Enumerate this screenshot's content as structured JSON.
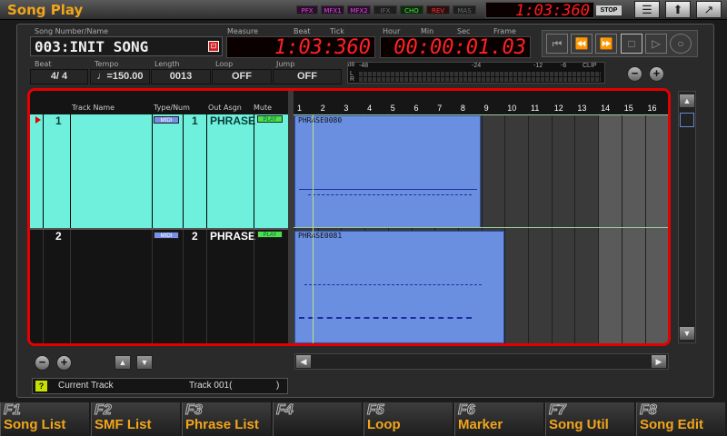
{
  "app": {
    "title": "Song Play"
  },
  "fx_badges": [
    {
      "label": "PFX",
      "color": "#d84ad8",
      "bg": "#2a0f2a"
    },
    {
      "label": "MFX1",
      "color": "#d84ad8",
      "bg": "#2a0f2a"
    },
    {
      "label": "MFX2",
      "color": "#d84ad8",
      "bg": "#2a0f2a"
    },
    {
      "label": "IFX",
      "color": "#666666",
      "bg": "#1e1e1e"
    },
    {
      "label": "CHO",
      "color": "#4ae04a",
      "bg": "#0f2a0f"
    },
    {
      "label": "REV",
      "color": "#ff3030",
      "bg": "#2a0f0f"
    },
    {
      "label": "MAS",
      "color": "#666666",
      "bg": "#1e1e1e"
    }
  ],
  "top_time": "1:03:360",
  "stop_label": "STOP",
  "top_icons": [
    "menu-icon",
    "up-arrow-icon",
    "export-icon"
  ],
  "song": {
    "number_label": "Song Number/Name",
    "number_value": "003:INIT SONG",
    "measure_label": "Measure",
    "beat_label": "Beat",
    "tick_label": "Tick",
    "measure_value": "1:03:360",
    "hour_label": "Hour",
    "min_label": "Min",
    "sec_label": "Sec",
    "frame_label": "Frame",
    "time_value": "00:00:01.03"
  },
  "params": {
    "beat_label": "Beat",
    "beat_value": "4/ 4",
    "tempo_label": "Tempo",
    "tempo_value": "♩=150.00",
    "length_label": "Length",
    "length_value": "0013",
    "loop_label": "Loop",
    "loop_value": "OFF",
    "jump_label": "Jump",
    "jump_value": "OFF"
  },
  "meter": {
    "db_label": "dB",
    "scale": [
      "-48",
      "-24",
      "-12",
      "-6",
      "CLIP"
    ],
    "left": "L",
    "right": "R"
  },
  "tracks_header": {
    "track_name": "Track Name",
    "type_num": "Type/Num",
    "out_assign": "Out Asgn",
    "mute": "Mute"
  },
  "tracks": [
    {
      "num": "1",
      "name": "",
      "type": "MIDI",
      "type_num": "1",
      "out": "PHRASE",
      "mute": "PLAY",
      "phrase": "PHRASE0080",
      "selected": true
    },
    {
      "num": "2",
      "name": "",
      "type": "MIDI",
      "type_num": "2",
      "out": "PHRASE",
      "mute": "PLAY",
      "phrase": "PHRASE0081",
      "selected": false
    }
  ],
  "measures": [
    "1",
    "2",
    "3",
    "4",
    "5",
    "6",
    "7",
    "8",
    "9",
    "10",
    "11",
    "12",
    "13",
    "14",
    "15",
    "16"
  ],
  "current_track": {
    "label": "Current Track",
    "value": "Track 001(",
    "close": ")"
  },
  "colors": {
    "accent": "#f2a51a",
    "selected_track": "#6ff0dc",
    "phrase_block": "#6b8fe0",
    "highlight_border": "#e50000",
    "led": "#ff2222"
  },
  "function_keys": [
    {
      "num": "F1",
      "label": "Song List"
    },
    {
      "num": "F2",
      "label": "SMF List"
    },
    {
      "num": "F3",
      "label": "Phrase List"
    },
    {
      "num": "F4",
      "label": ""
    },
    {
      "num": "F5",
      "label": "Loop"
    },
    {
      "num": "F6",
      "label": "Marker"
    },
    {
      "num": "F7",
      "label": "Song Util"
    },
    {
      "num": "F8",
      "label": "Song Edit"
    }
  ]
}
